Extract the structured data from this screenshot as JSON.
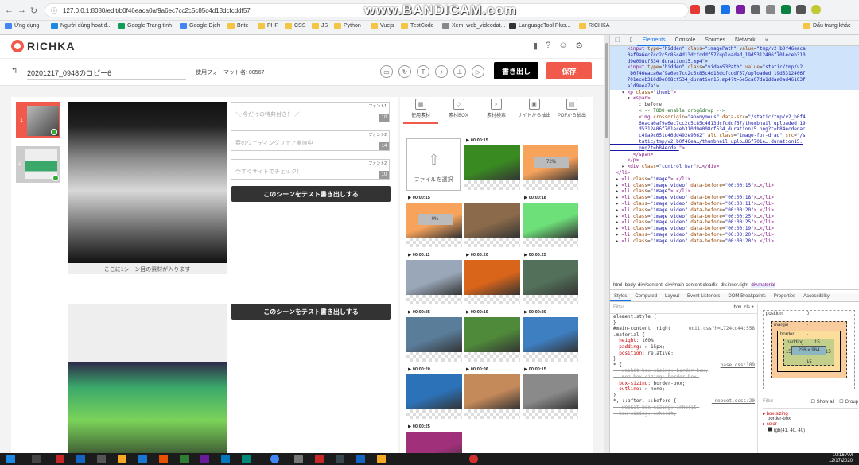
{
  "browser": {
    "url": "127.0.0.1:8080/edit/b0f46eaca0af9a6ec7cc2c5c85c4d13dcfcddf57",
    "watermark": "www.BANDICAM.com"
  },
  "bookmarks": [
    {
      "label": "Ứng dụng"
    },
    {
      "label": "Người dùng hoạt đ..."
    },
    {
      "label": "Google Trang tính"
    },
    {
      "label": "Google Dịch"
    },
    {
      "label": "Brite"
    },
    {
      "label": "PHP"
    },
    {
      "label": "CSS"
    },
    {
      "label": "JS"
    },
    {
      "label": "Python"
    },
    {
      "label": "Vuejs"
    },
    {
      "label": "TestCode"
    },
    {
      "label": "Xem: web_videodat..."
    },
    {
      "label": "LanguageTool Plus..."
    },
    {
      "label": "RICHKA"
    },
    {
      "label": "Dấu trang khác"
    }
  ],
  "app": {
    "logo": "RICHKA",
    "project_name": "20201217_0948のコピー6",
    "format_label": "使用フォーマット名: 00567",
    "export_label": "書き出し",
    "save_label": "保存",
    "scenes": [
      {
        "num": "1"
      },
      {
        "num": "2"
      }
    ],
    "caption1": "ここに1シーン目の素材が入ります",
    "text_fields": [
      {
        "text": "＼ 今だけの特典付き！ ／",
        "font": "フォント1",
        "count": "10"
      },
      {
        "text": "春のウェディングフェア実施中",
        "font": "フォント2",
        "count": "14"
      },
      {
        "text": "今すぐサイトでチェック！",
        "font": "フォント2",
        "count": "10"
      }
    ],
    "test_button": "このシーンをテスト書き出しする",
    "material_tabs": [
      {
        "label": "使用素材"
      },
      {
        "label": "素材BOX"
      },
      {
        "label": "素材検索"
      },
      {
        "label": "サイトから抽出"
      },
      {
        "label": "PDFから抽出"
      }
    ],
    "upload_label": "ファイルを選択",
    "materials": [
      {
        "dur": "00:00:15",
        "color": "#3a8a22",
        "label": ""
      },
      {
        "dur": "",
        "color": "#f7a35c",
        "label": "72%"
      },
      {
        "dur": "00:00:15",
        "color": "#f7a35c",
        "label": "0%"
      },
      {
        "dur": "",
        "color": "#8a6a4a",
        "label": ""
      },
      {
        "dur": "00:00:18",
        "color": "#6ee07a",
        "label": ""
      },
      {
        "dur": "00:00:11",
        "color": "#9aa7b8",
        "label": ""
      },
      {
        "dur": "00:00:20",
        "color": "#d9651a",
        "label": ""
      },
      {
        "dur": "00:00:25",
        "color": "#53705a",
        "label": ""
      },
      {
        "dur": "00:00:25",
        "color": "#5a7d9a",
        "label": ""
      },
      {
        "dur": "00:00:19",
        "color": "#4f8a3a",
        "label": ""
      },
      {
        "dur": "00:00:20",
        "color": "#3e7fc2",
        "label": ""
      },
      {
        "dur": "00:00:20",
        "color": "#2c72b8",
        "label": ""
      },
      {
        "dur": "00:00:06",
        "color": "#c48a5a",
        "label": ""
      },
      {
        "dur": "00:00:15",
        "color": "#8a8a8a",
        "label": ""
      },
      {
        "dur": "00:00:25",
        "color": "#a0307a",
        "label": ""
      }
    ]
  },
  "devtools": {
    "tabs": [
      {
        "label": "Elements"
      },
      {
        "label": "Console"
      },
      {
        "label": "Sources"
      },
      {
        "label": "Network"
      },
      {
        "label": "»"
      }
    ],
    "crumb": [
      "html",
      "body",
      "div#content",
      "div#main-content.clearfix",
      "div.inner.right",
      "div.material"
    ],
    "style_tabs": [
      {
        "label": "Styles"
      },
      {
        "label": "Computed"
      },
      {
        "label": "Layout"
      },
      {
        "label": "Event Listeners"
      },
      {
        "label": "DOM Breakpoints"
      },
      {
        "label": "Properties"
      },
      {
        "label": "Accessibility"
      }
    ],
    "filter": "Filter",
    "hov": ":hov .cls +",
    "box": {
      "position": "position",
      "margin": "margin",
      "border": "border",
      "padding": "padding",
      "content": "236 × 964",
      "pad": "15",
      "zero": "0",
      "dash": "-"
    },
    "computed": {
      "filter": "Filter",
      "show_all": "Show all",
      "group": "Group",
      "prop1": "box-sizing",
      "val1": "border-box",
      "prop2": "color",
      "val2": "rgb(41, 40, 40)"
    },
    "clock": {
      "time": "10:16 AM",
      "date": "12/17/2020"
    }
  }
}
